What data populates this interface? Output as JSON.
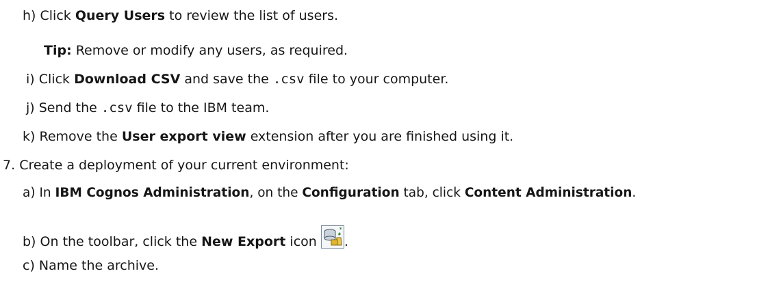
{
  "steps": {
    "h": {
      "marker": "h)",
      "pre": "Click ",
      "bold": "Query Users",
      "post": " to review the list of users."
    },
    "tip": {
      "label": "Tip:",
      "text": " Remove or modify any users, as required."
    },
    "i": {
      "marker": "i)",
      "pre": "Click ",
      "bold": "Download CSV",
      "mid": " and save the ",
      "code": ".csv",
      "post": " file to your computer."
    },
    "j": {
      "marker": "j)",
      "pre": "Send the ",
      "code": ".csv",
      "post": " file to the IBM team."
    },
    "k": {
      "marker": "k)",
      "pre": "Remove the ",
      "bold": "User export view",
      "post": " extension after you are finished using it."
    },
    "s7": {
      "marker": "7.",
      "text": "Create a deployment of your current environment:"
    },
    "a": {
      "marker": "a)",
      "pre": "In ",
      "bold1": "IBM Cognos Administration",
      "mid1": ", on the ",
      "bold2": "Configuration",
      "mid2": " tab, click ",
      "bold3": "Content Administration",
      "post": "."
    },
    "b": {
      "marker": "b)",
      "pre": "On the toolbar, click the ",
      "bold": "New Export",
      "post": " icon",
      "end": "."
    },
    "c": {
      "marker": "c)",
      "text": "Name the archive."
    }
  },
  "icons": {
    "new_export": "new-export-icon"
  }
}
